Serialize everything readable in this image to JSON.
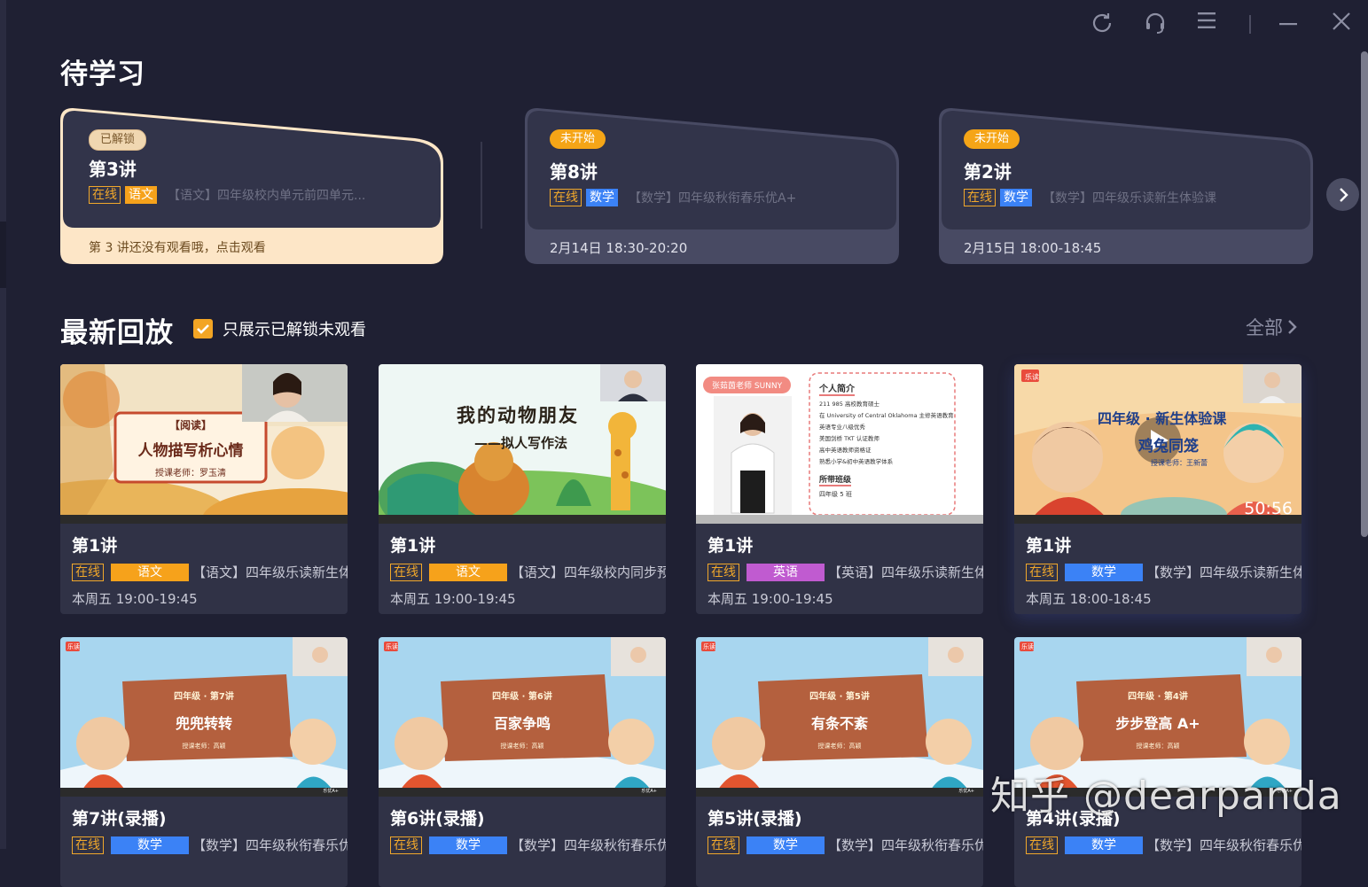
{
  "pending": {
    "title": "待学习",
    "cards": [
      {
        "status": "已解锁",
        "lesson": "第3讲",
        "online": "在线",
        "subject": "语文",
        "course": "【语文】四年级校内单元前四单元...",
        "footer": "第 3 讲还没有观看哦，点击观看"
      },
      {
        "status": "未开始",
        "lesson": "第8讲",
        "online": "在线",
        "subject": "数学",
        "course": "【数学】四年级秋衔春乐优A+",
        "footer": "2月14日 18:30-20:20"
      },
      {
        "status": "未开始",
        "lesson": "第2讲",
        "online": "在线",
        "subject": "数学",
        "course": "【数学】四年级乐读新生体验课",
        "footer": "2月15日 18:00-18:45"
      }
    ]
  },
  "replay": {
    "title": "最新回放",
    "filter_label": "只展示已解锁未观看",
    "all_label": "全部",
    "cards": [
      {
        "lesson": "第1讲",
        "online": "在线",
        "subject": "语文",
        "course": "【语文】四年级乐读新生体",
        "time": "本周五 19:00-19:45",
        "thumb": {
          "tag": "【阅读】",
          "main": "人物描写析心情",
          "sub": "授课老师：罗玉清"
        }
      },
      {
        "lesson": "第1讲",
        "online": "在线",
        "subject": "语文",
        "course": "【语文】四年级校内同步预",
        "time": "本周五 19:00-19:45",
        "thumb": {
          "main": "我的动物朋友",
          "sub": "——拟人写作法"
        }
      },
      {
        "lesson": "第1讲",
        "online": "在线",
        "subject": "英语",
        "course": "【英语】四年级乐读新生体",
        "time": "本周五 19:00-19:45",
        "thumb": {
          "badge": "张茹茵老师 SUNNY",
          "heading": "个人简介",
          "lines": [
            "211 985 高校教育硕士",
            "在 University of Central Oklahoma 主修英语教育",
            "英语专业八级优秀",
            "美国剑桥 TKT 认证教师",
            "高中英语教师资格证",
            "熟悉小学&初中英语教学体系"
          ],
          "class_heading": "所带班级",
          "class_line": "四年级 5 班"
        }
      },
      {
        "lesson": "第1讲",
        "online": "在线",
        "subject": "数学",
        "course": "【数学】四年级乐读新生体",
        "time": "本周五 18:00-18:45",
        "thumb": {
          "logo": "乐读",
          "main": "四年级 · 新生体验课",
          "sub": "鸡兔同笼",
          "teacher": "授课老师：王新蕾",
          "duration": "50:56"
        }
      },
      {
        "lesson": "第7讲(录播)",
        "online": "在线",
        "subject": "数学",
        "course": "【数学】四年级秋衔春乐优",
        "thumb": {
          "logo": "乐读",
          "grade": "四年级 · 第7讲",
          "main": "兜兜转转",
          "teacher": "授课老师：高颖",
          "brand": "乐优A+"
        }
      },
      {
        "lesson": "第6讲(录播)",
        "online": "在线",
        "subject": "数学",
        "course": "【数学】四年级秋衔春乐优",
        "thumb": {
          "logo": "乐读",
          "grade": "四年级 · 第6讲",
          "main": "百家争鸣",
          "teacher": "授课老师：高颖",
          "brand": "乐优A+"
        }
      },
      {
        "lesson": "第5讲(录播)",
        "online": "在线",
        "subject": "数学",
        "course": "【数学】四年级秋衔春乐优",
        "thumb": {
          "logo": "乐读",
          "grade": "四年级 · 第5讲",
          "main": "有条不紊",
          "teacher": "授课老师：高颖",
          "brand": "乐优A+"
        }
      },
      {
        "lesson": "第4讲(录播)",
        "online": "在线",
        "subject": "数学",
        "course": "【数学】四年级秋衔春乐优",
        "thumb": {
          "logo": "乐读",
          "grade": "四年级 · 第4讲",
          "main": "步步登高 A+",
          "teacher": "授课老师：高颖",
          "brand": "乐优A+"
        }
      }
    ]
  },
  "watermark": "知乎 @dearpanda",
  "colors": {
    "bg": "#1f2033",
    "accent": "#f3a524",
    "chinese": "#f6a21b",
    "math": "#3b82f6",
    "english": "#c05bd0",
    "online": "#f1a82b"
  },
  "icons": [
    "refresh-icon",
    "headset-icon",
    "menu-icon",
    "minimize-icon",
    "close-icon",
    "chevron-right-icon",
    "check-icon",
    "play-icon"
  ]
}
